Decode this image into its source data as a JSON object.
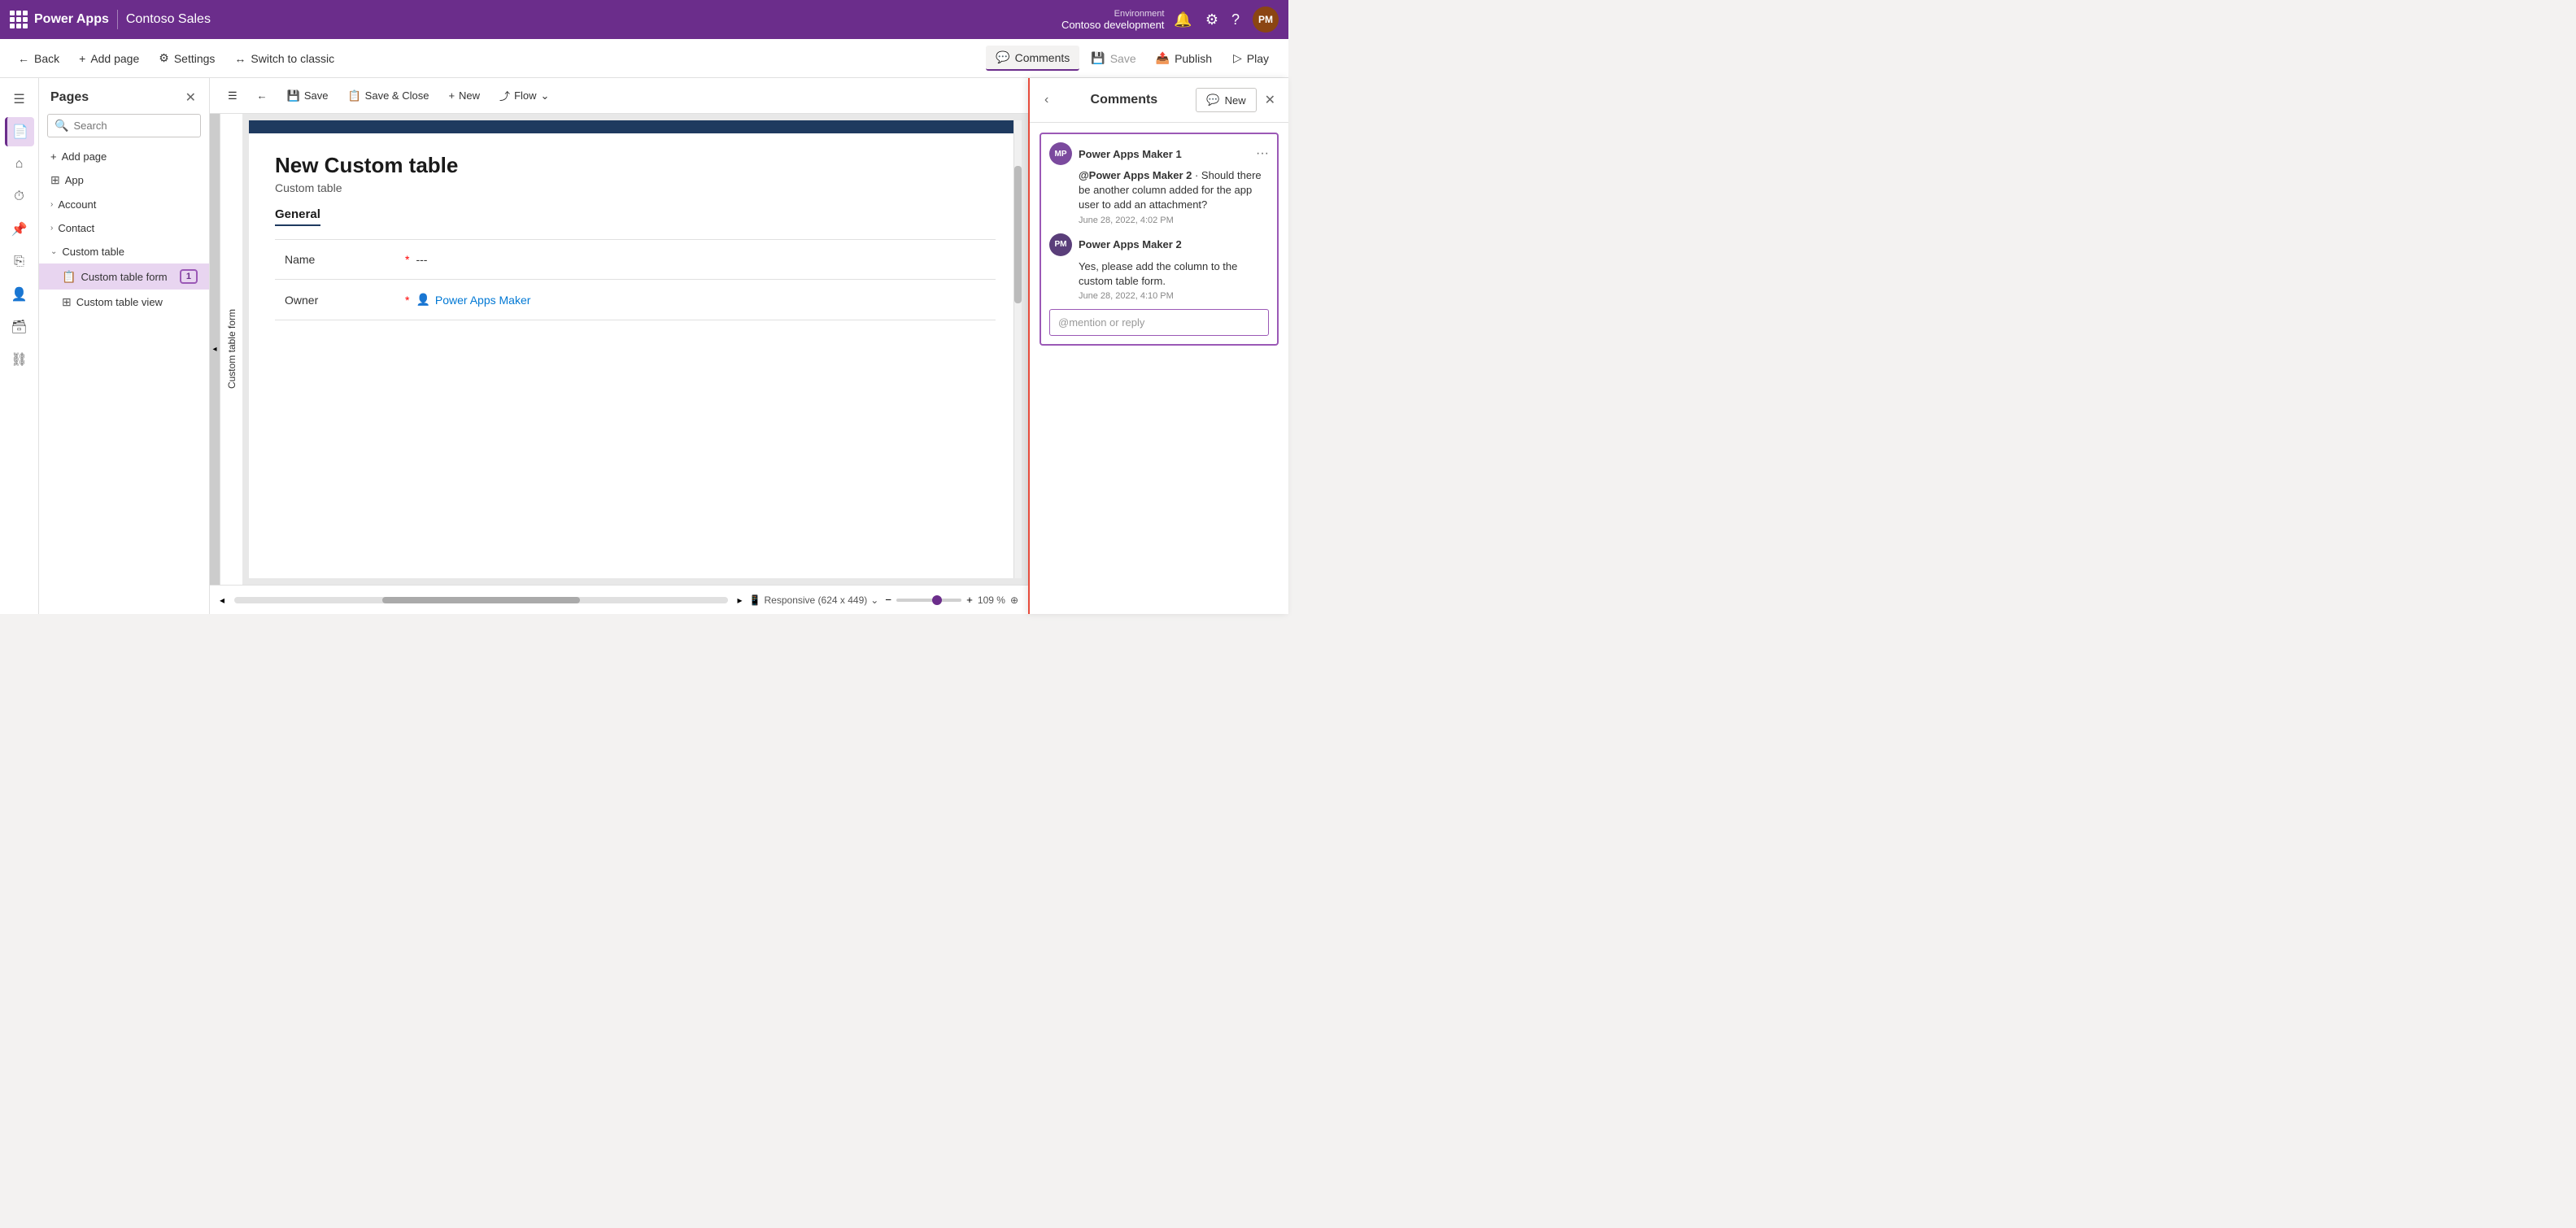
{
  "topNav": {
    "gridLabel": "apps-grid",
    "title": "Power Apps",
    "divider": "|",
    "subtitle": "Contoso Sales",
    "environment": {
      "label": "Environment",
      "name": "Contoso development"
    },
    "avatar": "PM"
  },
  "secondNav": {
    "back": "Back",
    "addPage": "Add page",
    "settings": "Settings",
    "switchToClassic": "Switch to classic",
    "comments": "Comments",
    "save": "Save",
    "publish": "Publish",
    "play": "Play"
  },
  "pagesPanel": {
    "title": "Pages",
    "searchPlaceholder": "Search",
    "addPage": "Add page",
    "items": [
      {
        "id": "app",
        "label": "App",
        "type": "app",
        "indent": 0
      },
      {
        "id": "account",
        "label": "Account",
        "type": "group",
        "indent": 0
      },
      {
        "id": "contact",
        "label": "Contact",
        "type": "group",
        "indent": 0
      },
      {
        "id": "custom-table",
        "label": "Custom table",
        "type": "group-open",
        "indent": 0
      },
      {
        "id": "custom-table-form",
        "label": "Custom table form",
        "type": "form",
        "indent": 1,
        "badge": "1"
      },
      {
        "id": "custom-table-view",
        "label": "Custom table view",
        "type": "view",
        "indent": 1
      }
    ]
  },
  "canvasToolbar": {
    "save": "Save",
    "saveClose": "Save & Close",
    "new": "New",
    "flow": "Flow"
  },
  "formContent": {
    "title": "New Custom table",
    "subtitle": "Custom table",
    "tab": "General",
    "fields": [
      {
        "label": "Name",
        "required": true,
        "value": "---",
        "type": "text"
      },
      {
        "label": "Owner",
        "required": true,
        "value": "Power Apps Maker",
        "type": "link"
      }
    ]
  },
  "verticalLabel": "Custom table form",
  "bottomBar": {
    "responsive": "Responsive (624 x 449)",
    "zoomMinus": "−",
    "zoomPlus": "+",
    "zoom": "109 %"
  },
  "commentsPanel": {
    "title": "Comments",
    "newBtn": "New",
    "thread": {
      "author1": "Power Apps Maker 1",
      "avatar1": "MP",
      "text1": "@Power Apps Maker 2· Should there be another column added for the app user to add an attachment?",
      "time1": "June 28, 2022, 4:02 PM",
      "author2": "Power Apps Maker 2",
      "avatar2": "PM",
      "text2": "Yes, please add the column to the custom table form.",
      "time2": "June 28, 2022, 4:10 PM",
      "replyPlaceholder": "@mention or reply"
    }
  }
}
